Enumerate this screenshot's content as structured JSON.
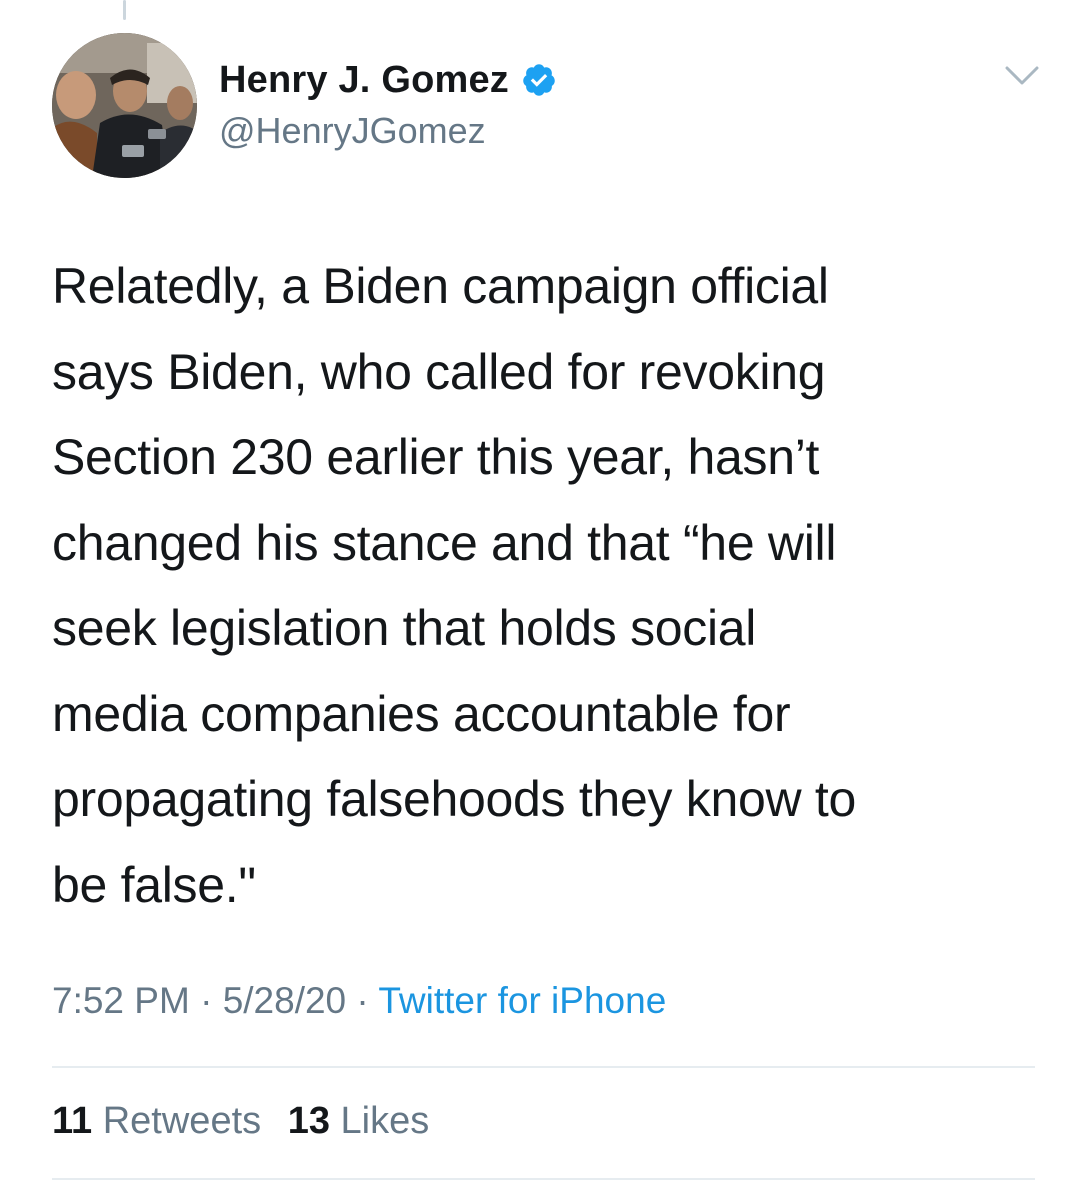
{
  "author": {
    "display_name": "Henry J. Gomez",
    "handle": "@HenryJGomez",
    "verified": true,
    "verified_icon": "verified-badge-icon",
    "avatar_icon": "profile-photo"
  },
  "menu": {
    "icon": "chevron-down-icon"
  },
  "tweet": {
    "text": "Relatedly, a Biden campaign official\nsays Biden, who called for revoking\nSection 230 earlier this year, hasn’t\nchanged his stance and that “he will\nseek legislation that holds social\nmedia companies accountable for\npropagating falsehoods they know to\nbe false.\""
  },
  "meta": {
    "time": "7:52 PM",
    "date": "5/28/20",
    "separator": " · ",
    "source": "Twitter for iPhone"
  },
  "stats": {
    "retweets_count": "11",
    "retweets_label": "Retweets",
    "likes_count": "13",
    "likes_label": "Likes"
  },
  "colors": {
    "accent": "#1b95e0",
    "secondary_text": "#657786",
    "primary_text": "#14171a",
    "divider": "#e6ecf0",
    "verified_badge": "#1da1f2"
  }
}
